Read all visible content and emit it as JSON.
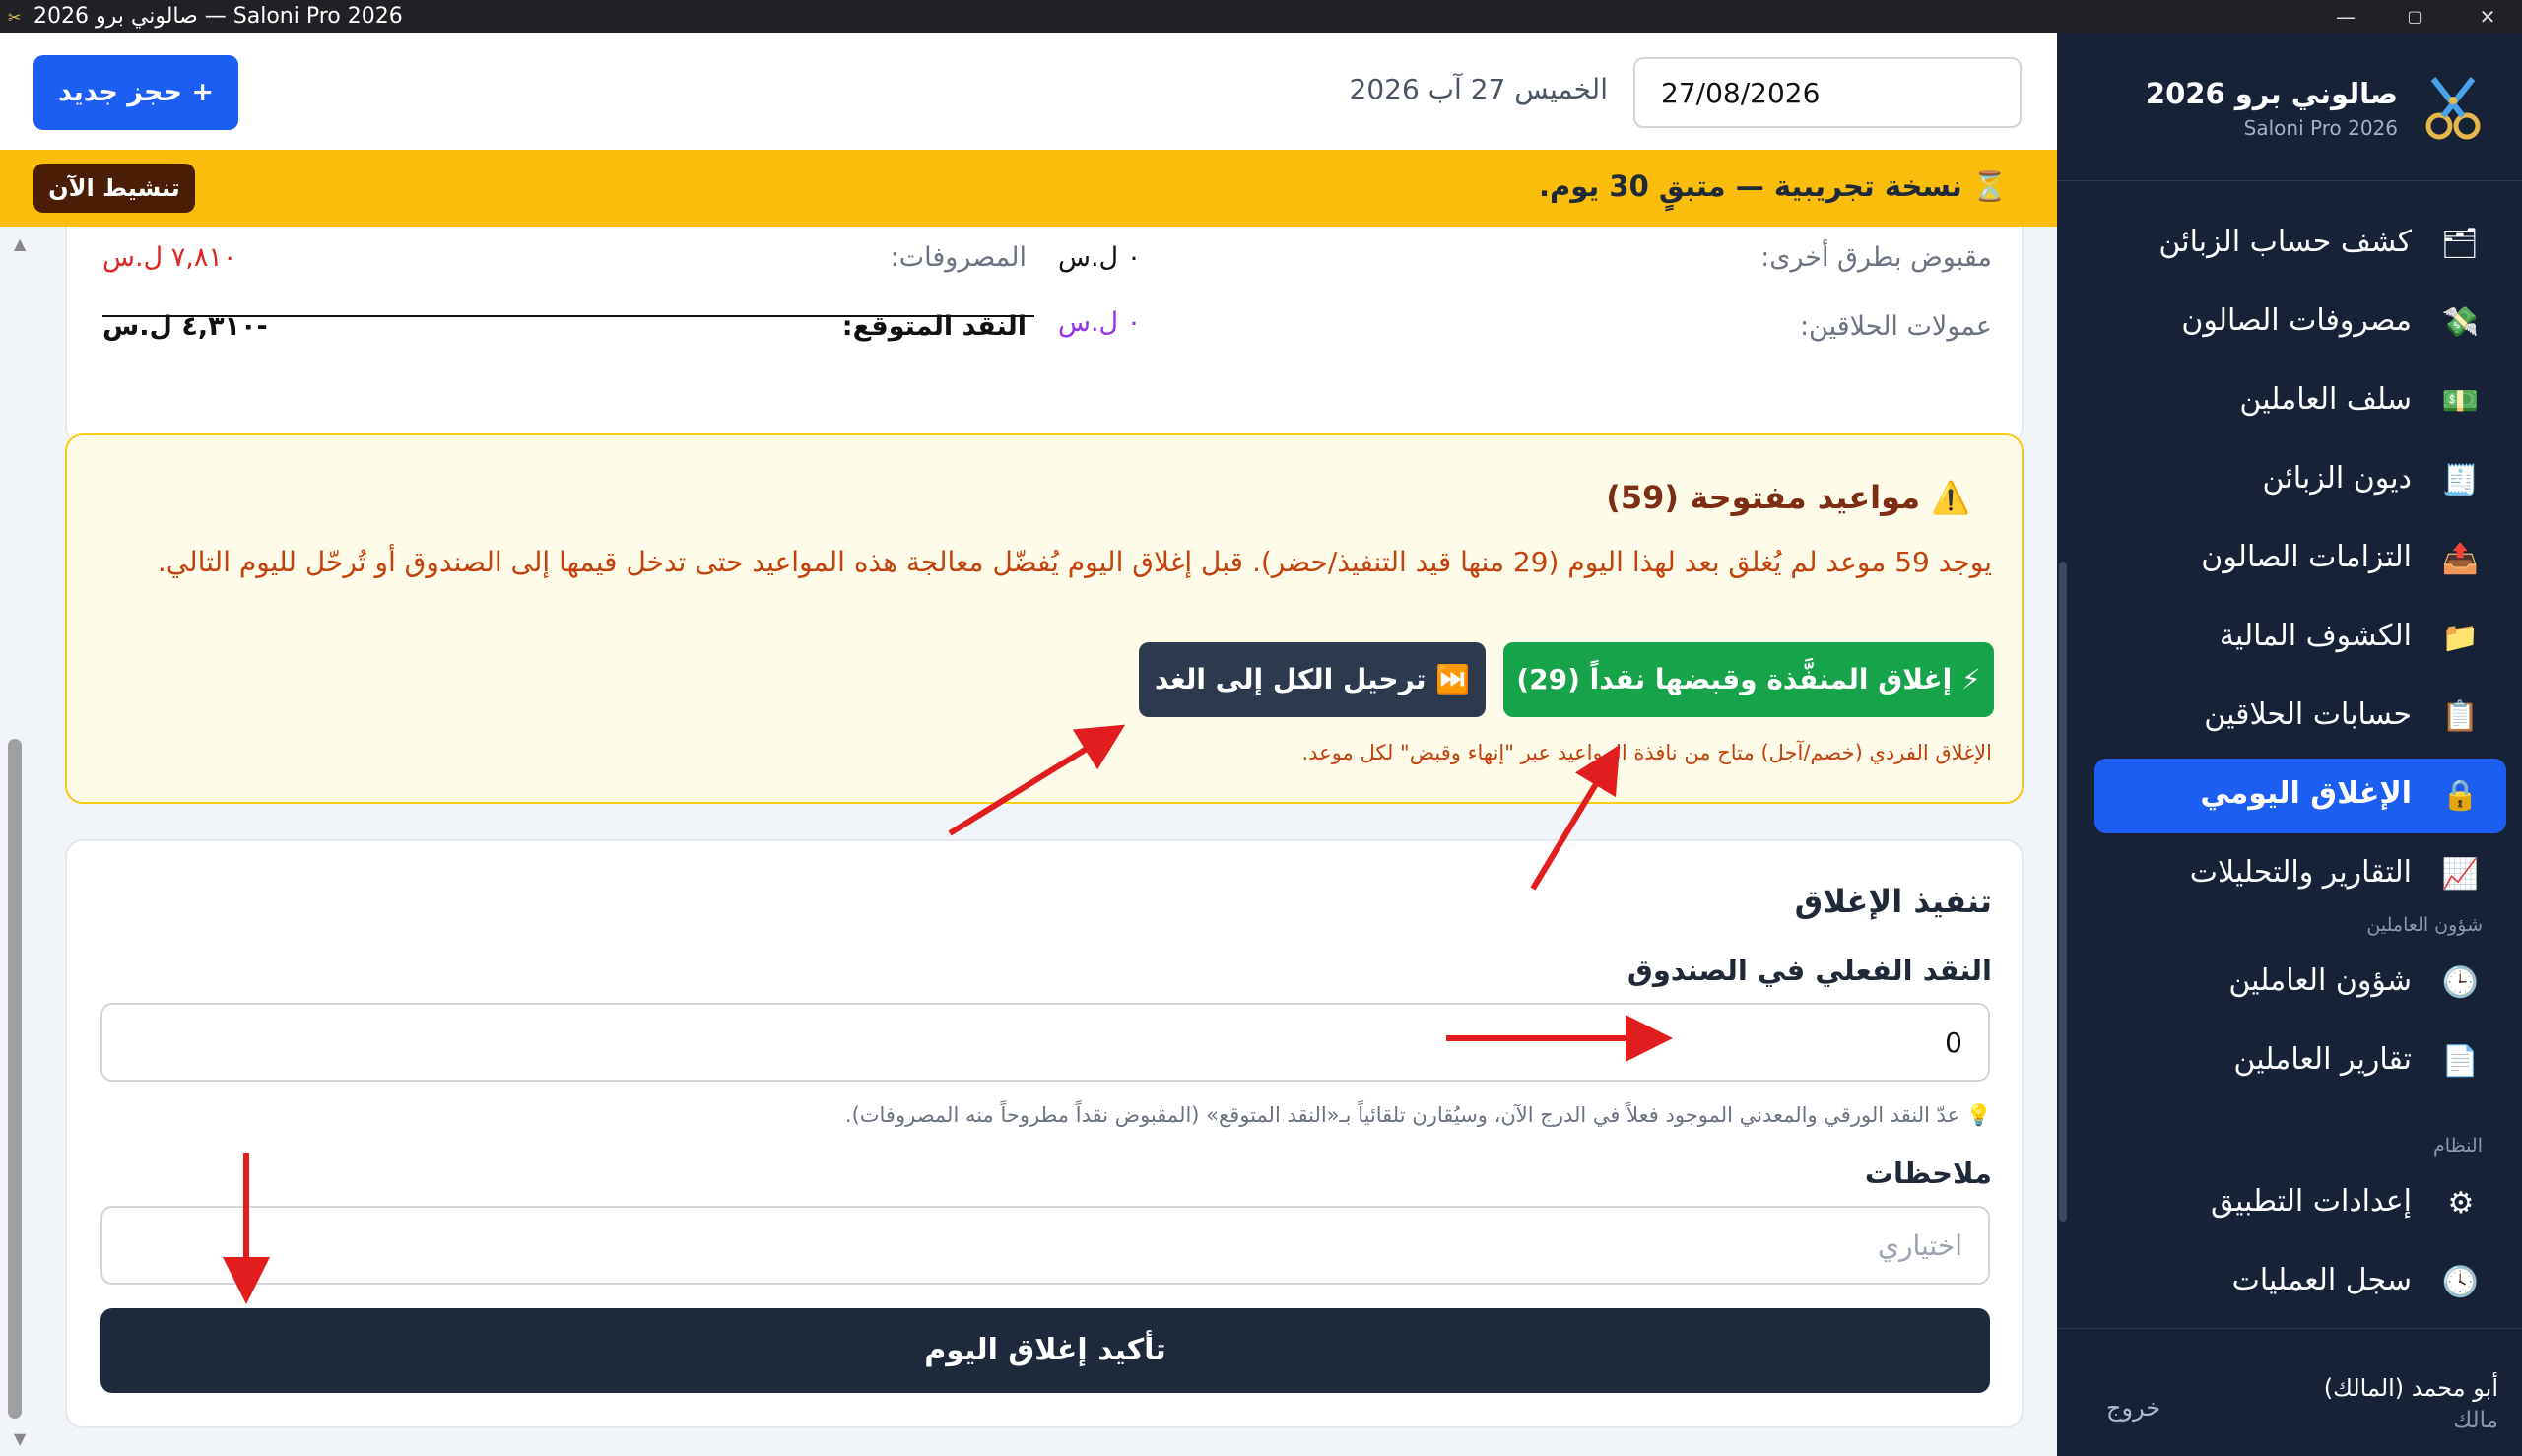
{
  "window": {
    "title": "صالوني برو 2026 — Saloni Pro 2026",
    "controls": {
      "minimize": "—",
      "maximize": "▢",
      "close": "✕"
    }
  },
  "header": {
    "new_booking_label": "+ حجز جديد",
    "date_text": "الخميس 27 آب 2026",
    "date_value": "27/08/2026"
  },
  "trial": {
    "icon": "hourglass-icon",
    "message": "⏳ نسخة تجريبية — متبقٍ 30 يوم.",
    "activate_label": "تنشيط الآن"
  },
  "summary": {
    "other_methods_label": "مقبوض بطرق أخرى:",
    "other_methods_value": "٠ ل.س",
    "barber_commissions_label": "عمولات الحلاقين:",
    "barber_commissions_value": "٠ ل.س",
    "expenses_label": "المصروفات:",
    "expenses_value": "٧,٨١٠ ل.س",
    "expected_cash_label": "النقد المتوقع:",
    "expected_cash_value": "-٤,٣١٠ ل.س"
  },
  "open_appointments": {
    "title": "⚠️ مواعيد مفتوحة (59)",
    "body": "يوجد 59 موعد لم يُغلق بعد لهذا اليوم (29 منها قيد التنفيذ/حضر). قبل إغلاق اليوم يُفضّل معالجة هذه المواعيد حتى تدخل قيمها إلى الصندوق أو تُرحّل لليوم التالي.",
    "close_paid_label": "⚡ إغلاق المنفَّذة وقبضها نقداً (29)",
    "carry_all_label": "⏭️ ترحيل الكل إلى الغد",
    "note": "الإغلاق الفردي (خصم/آجل) متاح من نافذة المواعيد عبر \"إنهاء وقبض\" لكل موعد."
  },
  "closing": {
    "title": "تنفيذ الإغلاق",
    "cash_label": "النقد الفعلي في الصندوق",
    "cash_value": "0",
    "hint": "💡 عدّ النقد الورقي والمعدني الموجود فعلاً في الدرج الآن، وسيُقارن تلقائياً بـ«النقد المتوقع» (المقبوض نقداً مطروحاً منه المصروفات).",
    "notes_label": "ملاحظات",
    "notes_placeholder": "اختياري",
    "confirm_label": "تأكيد إغلاق اليوم"
  },
  "sidebar": {
    "brand_name": "صالوني برو 2026",
    "brand_sub": "Saloni Pro 2026",
    "items": [
      {
        "label": "كشف حساب الزبائن",
        "icon": "🗂"
      },
      {
        "label": "مصروفات الصالون",
        "icon": "💸"
      },
      {
        "label": "سلف العاملين",
        "icon": "💵"
      },
      {
        "label": "ديون الزبائن",
        "icon": "🧾"
      },
      {
        "label": "التزامات الصالون",
        "icon": "📤"
      },
      {
        "label": "الكشوف المالية",
        "icon": "📁"
      },
      {
        "label": "حسابات الحلاقين",
        "icon": "📋"
      },
      {
        "label": "الإغلاق اليومي",
        "icon": "🔒"
      },
      {
        "label": "التقارير والتحليلات",
        "icon": "📈"
      }
    ],
    "section_staff": "شؤون العاملين",
    "staff_items": [
      {
        "label": "شؤون العاملين",
        "icon": "🕒"
      },
      {
        "label": "تقارير العاملين",
        "icon": "📄"
      }
    ],
    "section_system": "النظام",
    "system_items": [
      {
        "label": "إعدادات التطبيق",
        "icon": "⚙"
      },
      {
        "label": "سجل العمليات",
        "icon": "🕓"
      }
    ],
    "user_name": "أبو محمد (المالك)",
    "user_role": "مالك",
    "logout_label": "خروج"
  },
  "colors": {
    "accent": "#1d5ef2",
    "sidebar_bg": "#182236",
    "trial_bg": "#fbbd0c",
    "success": "#16a34a",
    "danger": "#dc2626",
    "commission": "#9333ea",
    "annotation_arrow": "#e11d1d"
  }
}
